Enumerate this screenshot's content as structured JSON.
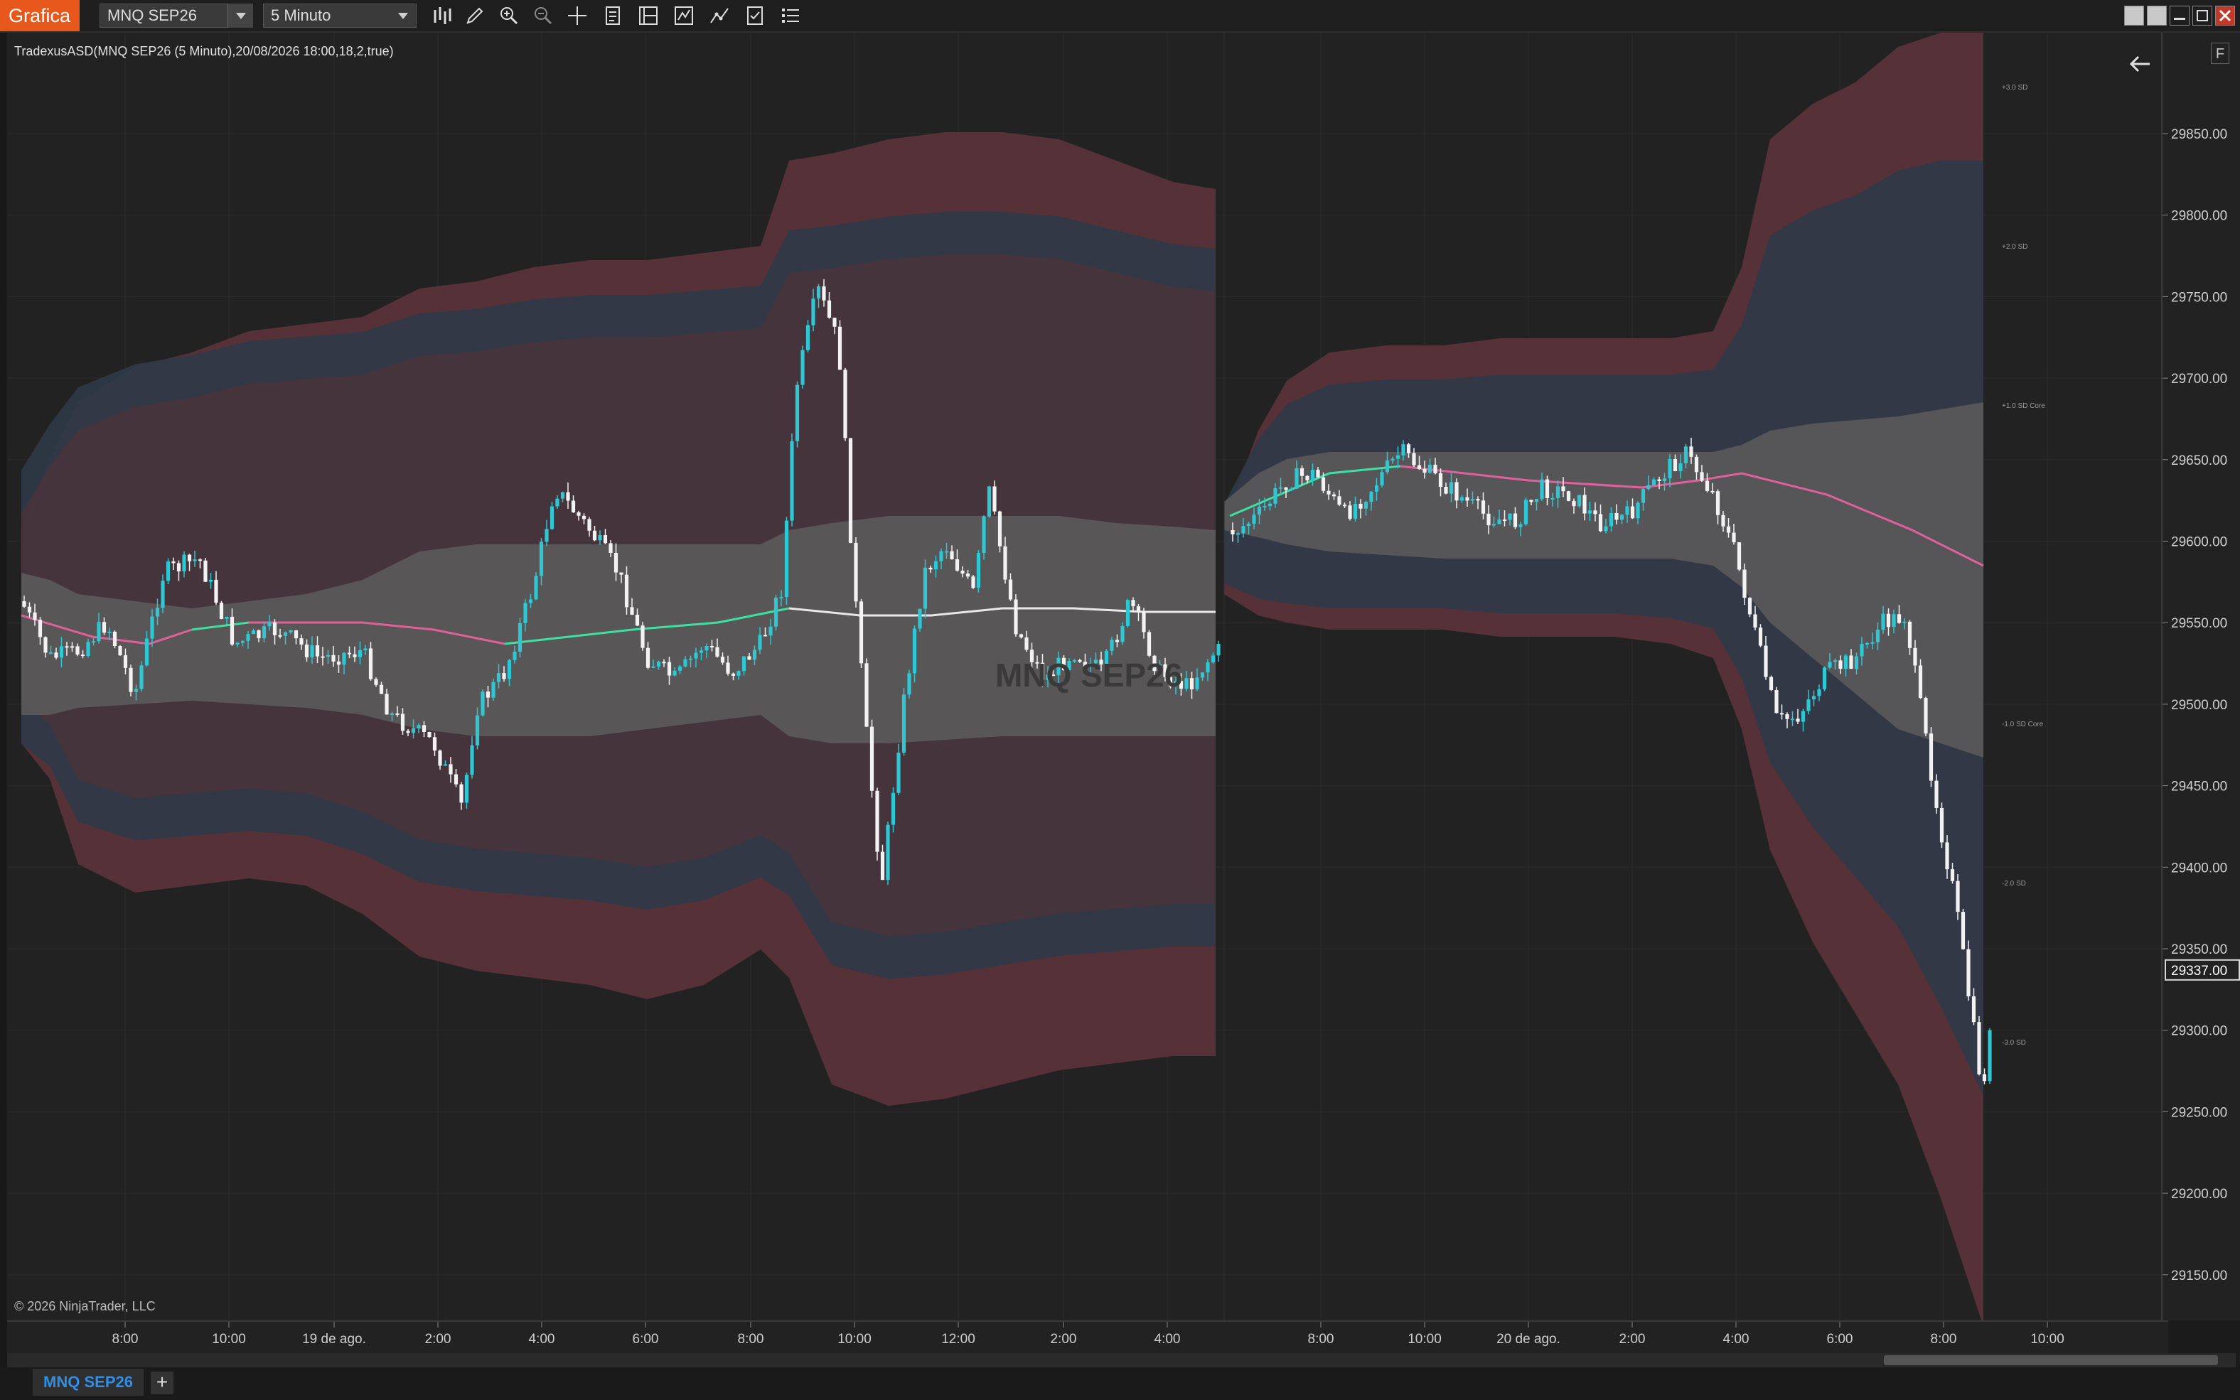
{
  "app": {
    "title": "Grafica"
  },
  "toolbar": {
    "instrument": "MNQ SEP26",
    "timeframe": "5 Minuto",
    "tools": [
      "bar-type-icon",
      "pencil-icon",
      "zoom-in-icon",
      "zoom-out-icon",
      "crosshair-icon",
      "data-box-icon",
      "indicators-icon",
      "strategies-icon",
      "drawing-tools-icon",
      "properties-icon",
      "list-icon"
    ]
  },
  "chart": {
    "indicator_label": "TradexusASD(MNQ SEP26 (5 Minuto),20/08/2026 18:00,18,2,true)",
    "watermark": "MNQ SEP26",
    "copyright": "© 2026 NinjaTrader, LLC",
    "f_button": "F",
    "current_price": "29337.00",
    "price_labels": [
      "29850.00",
      "29800.00",
      "29750.00",
      "29700.00",
      "29650.00",
      "29600.00",
      "29550.00",
      "29500.00",
      "29450.00",
      "29400.00",
      "29350.00",
      "29300.00",
      "29250.00",
      "29200.00",
      "29150.00"
    ],
    "time_labels": [
      "8:00",
      "10:00",
      "19 de ago.",
      "2:00",
      "4:00",
      "6:00",
      "8:00",
      "10:00",
      "12:00",
      "2:00",
      "4:00",
      "8:00",
      "10:00",
      "20 de ago.",
      "2:00",
      "4:00",
      "6:00",
      "8:00",
      "10:00"
    ],
    "band_labels": [
      "+3.0 SD",
      "+2.0 SD",
      "+1.0 SD Core",
      "-1.0 SD Core",
      "-2.0 SD",
      "-3.0 SD"
    ],
    "colors": {
      "background": "#222222",
      "bull": "#2fc7d3",
      "bear": "#f2f2f2",
      "outer_band": "#5a3339",
      "mid_band": "#2f3a47",
      "core_band": "#5a5a5a",
      "vwap_up": "#3ee0a4",
      "vwap_down": "#e0609a"
    }
  },
  "tabs": [
    {
      "label": "MNQ SEP26"
    }
  ]
}
